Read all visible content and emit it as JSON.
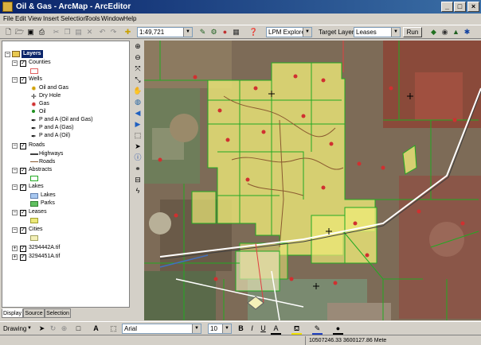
{
  "window": {
    "title": "Oil & Gas - ArcMap - ArcEditor",
    "minimize": "_",
    "maximize": "□",
    "close": "×"
  },
  "menu": [
    "File",
    "Edit",
    "View",
    "Insert",
    "Selection",
    "Tools",
    "Window",
    "Help"
  ],
  "toolbar": {
    "scale": "1:49,721",
    "tool_combo": "LPM Explorer",
    "target_layer_label": "Target Layer:",
    "target_layer": "Leases",
    "run_label": "Run"
  },
  "toc": {
    "root": "Layers",
    "counties": "Counties",
    "wells": "Wells",
    "wells_items": [
      "Oil and Gas",
      "Dry Hole",
      "Gas",
      "Oil",
      "P and A (Oil and Gas)",
      "P and A (Gas)",
      "P and A (Oil)"
    ],
    "roads": "Roads",
    "roads_items": [
      "Highways",
      "Roads"
    ],
    "abstracts": "Abstracts",
    "lakes": "Lakes",
    "lakes_items": [
      "Lakes",
      "Parks"
    ],
    "leases": "Leases",
    "cities": "Cities",
    "raster1": "3294442A.tif",
    "raster2": "3294451A.tif"
  },
  "tabs": [
    "Display",
    "Source",
    "Selection"
  ],
  "drawing": {
    "label": "Drawing",
    "font": "Arial",
    "size": "10",
    "bold": "B",
    "italic": "I",
    "underline": "U",
    "text_tool": "A"
  },
  "status": {
    "coords": "10507246.33  3600127.86 Mete"
  },
  "colors": {
    "lease_fill": "#ece878",
    "abstract_line": "#22aa22",
    "window_title": "#0a246a",
    "map_base": "#7a6a55"
  }
}
